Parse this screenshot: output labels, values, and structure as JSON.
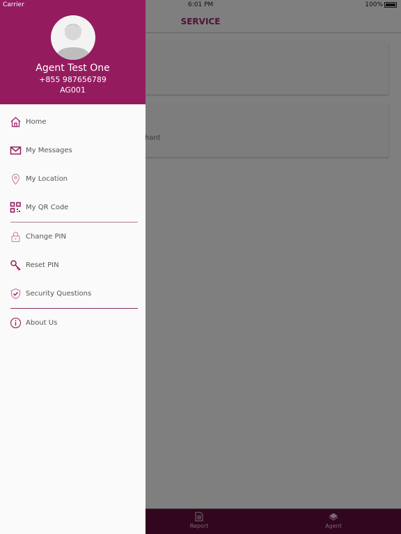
{
  "status": {
    "carrier": "Carrier",
    "time": "6:01 PM",
    "battery": "100%"
  },
  "header": {
    "title": "SERVICE"
  },
  "cards": [
    {
      "text": ""
    },
    {
      "text": "hant"
    }
  ],
  "tabs": [
    {
      "label": "Report",
      "icon": "document-icon"
    },
    {
      "label": "Agent",
      "icon": "money-icon"
    }
  ],
  "profile": {
    "name": "Agent Test One",
    "phone": "+855 987656789",
    "code": "AG001"
  },
  "menu": [
    {
      "label": "Home",
      "icon": "home-icon"
    },
    {
      "label": "My Messages",
      "icon": "mail-icon"
    },
    {
      "label": "My Location",
      "icon": "location-pin-icon"
    },
    {
      "label": "My QR Code",
      "icon": "qr-code-icon"
    },
    {
      "label": "Change PIN",
      "icon": "lock-icon"
    },
    {
      "label": "Reset PIN",
      "icon": "key-icon"
    },
    {
      "label": "Security Questions",
      "icon": "shield-check-icon"
    },
    {
      "label": "About Us",
      "icon": "info-icon"
    }
  ],
  "colors": {
    "brand": "#951b5f",
    "tabbar": "#32061e"
  }
}
